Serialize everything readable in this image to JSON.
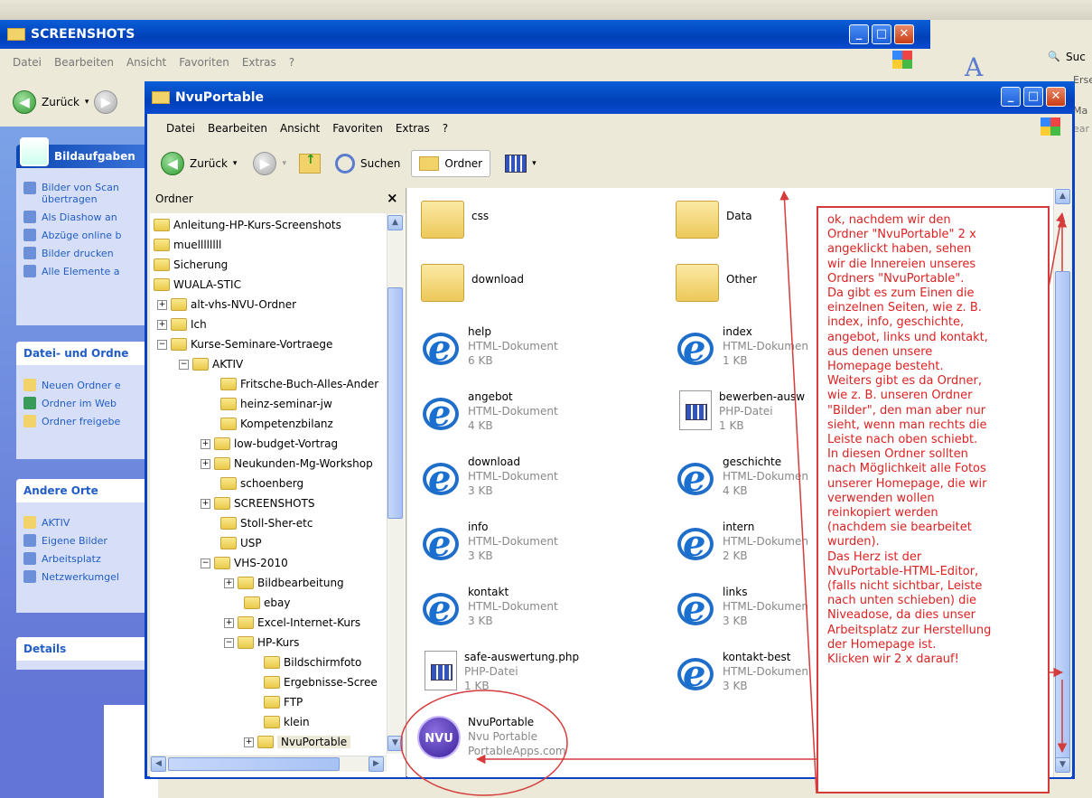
{
  "back_window": {
    "title": "SCREENSHOTS",
    "menu": [
      "Datei",
      "Bearbeiten",
      "Ansicht",
      "Favoriten",
      "Extras",
      "?"
    ],
    "back_label": "Zurück"
  },
  "right_partial": {
    "search": "Suc",
    "line1": "Erse",
    "line2": "Ma",
    "line3": "ear"
  },
  "task_panels": {
    "bild": {
      "title": "Bildaufgaben",
      "items": [
        "Bilder von Scan übertragen",
        "Als Diashow an",
        "Abzüge online b",
        "Bilder drucken",
        "Alle Elemente a"
      ]
    },
    "datei": {
      "title": "Datei- und Ordne",
      "items": [
        "Neuen Ordner e",
        "Ordner im Web",
        "Ordner freigebe"
      ]
    },
    "orte": {
      "title": "Andere Orte",
      "items": [
        "AKTIV",
        "Eigene Bilder",
        "Arbeitsplatz",
        "Netzwerkumgel"
      ]
    },
    "details": {
      "title": "Details"
    }
  },
  "main_window": {
    "title": "NvuPortable",
    "menu": [
      "Datei",
      "Bearbeiten",
      "Ansicht",
      "Favoriten",
      "Extras",
      "?"
    ],
    "toolbar": {
      "back": "Zurück",
      "search": "Suchen",
      "folders": "Ordner"
    }
  },
  "tree": {
    "header": "Ordner",
    "close": "×",
    "rows": [
      "Anleitung-HP-Kurs-Screenshots",
      "muellllllll",
      "Sicherung",
      "WUALA-STIC",
      "alt-vhs-NVU-Ordner",
      "Ich",
      "Kurse-Seminare-Vortraege",
      "AKTIV",
      "Fritsche-Buch-Alles-Ander",
      "heinz-seminar-jw",
      "Kompetenzbilanz",
      "low-budget-Vortrag",
      "Neukunden-Mg-Workshop",
      "schoenberg",
      "SCREENSHOTS",
      "Stoll-Sher-etc",
      "USP",
      "VHS-2010",
      "Bildbearbeitung",
      "ebay",
      "Excel-Internet-Kurs",
      "HP-Kurs",
      "Bildschirmfoto",
      "Ergebnisse-Scree",
      "FTP",
      "klein",
      "NvuPortable"
    ]
  },
  "files": [
    {
      "name": "css",
      "type": "",
      "size": ""
    },
    {
      "name": "Data",
      "type": "",
      "size": ""
    },
    {
      "name": "download",
      "type": "",
      "size": ""
    },
    {
      "name": "Other",
      "type": "",
      "size": ""
    },
    {
      "name": "help",
      "type": "HTML-Dokument",
      "size": "6 KB"
    },
    {
      "name": "index",
      "type": "HTML-Dokumen",
      "size": "1 KB"
    },
    {
      "name": "angebot",
      "type": "HTML-Dokument",
      "size": "4 KB"
    },
    {
      "name": "bewerben-ausw",
      "type": "PHP-Datei",
      "size": "1 KB"
    },
    {
      "name": "download",
      "type": "HTML-Dokument",
      "size": "3 KB"
    },
    {
      "name": "geschichte",
      "type": "HTML-Dokumen",
      "size": "4 KB"
    },
    {
      "name": "info",
      "type": "HTML-Dokument",
      "size": "3 KB"
    },
    {
      "name": "intern",
      "type": "HTML-Dokumen",
      "size": "2 KB"
    },
    {
      "name": "kontakt",
      "type": "HTML-Dokument",
      "size": "3 KB"
    },
    {
      "name": "links",
      "type": "HTML-Dokumen",
      "size": "3 KB"
    },
    {
      "name": "safe-auswertung.php",
      "type": "PHP-Datei",
      "size": "1 KB"
    },
    {
      "name": "kontakt-best",
      "type": "HTML-Dokumen",
      "size": "3 KB"
    },
    {
      "name": "NvuPortable",
      "type": "Nvu Portable",
      "size": "PortableApps.com"
    }
  ],
  "nvu_logo": "NVU",
  "annotation": "ok, nachdem wir den\nOrdner \"NvuPortable\" 2 x\nangeklickt haben, sehen\nwir die Innereien unseres\nOrdners \"NvuPortable\".\nDa gibt es zum Einen die\neinzelnen Seiten, wie z. B.\nindex, info, geschichte,\nangebot, links und kontakt,\naus denen unsere\nHomepage besteht.\nWeiters gibt es da Ordner,\nwie z. B. unseren Ordner\n\"Bilder\", den man aber nur\nsieht, wenn man rechts die\nLeiste nach oben schiebt.\nIn diesen Ordner sollten\nnach Möglichkeit alle Fotos\nunserer Homepage, die wir\nverwenden wollen\nreinkopiert werden\n(nachdem sie bearbeitet\nwurden).\nDas Herz ist der\nNvuPortable-HTML-Editor,\n(falls nicht sichtbar, Leiste\nnach unten schieben) die\nNiveadose, da dies unser\nArbeitsplatz zur Herstellung\nder Homepage ist.\nKlicken wir 2 x darauf!",
  "colors": {
    "annotation": "#d63b3b",
    "xp_blue": "#0a5fd8",
    "task_bg": "#6375d6"
  }
}
